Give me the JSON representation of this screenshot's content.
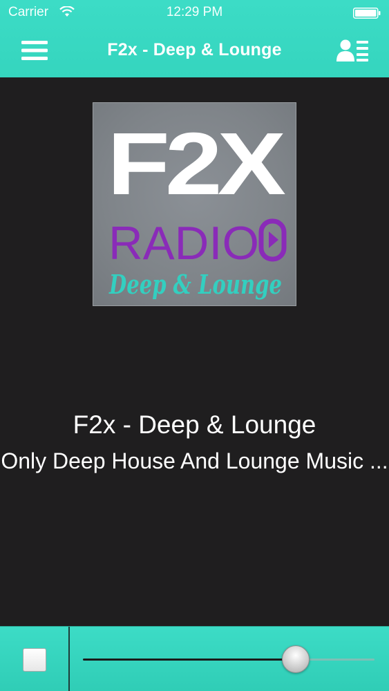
{
  "status_bar": {
    "carrier": "Carrier",
    "time": "12:29 PM",
    "wifi_icon": "wifi-icon",
    "battery_icon": "battery-icon"
  },
  "nav": {
    "title": "F2x - Deep & Lounge",
    "left_icon": "menu-icon",
    "right_icon": "profile-list-icon"
  },
  "artwork": {
    "logo_top": "F2X",
    "logo_middle": "RADIO",
    "logo_bottom": "Deep & Lounge",
    "colors": {
      "logo_white": "#ffffff",
      "radio_purple": "#8a2bb8",
      "script_teal": "#33cfc0"
    }
  },
  "station": {
    "name": "F2x - Deep & Lounge",
    "description": "Only Deep House And Lounge Music ..."
  },
  "player": {
    "stop_icon": "stop-icon",
    "volume_fraction": 0.73
  },
  "colors": {
    "accent": "#3cdcc6",
    "background": "#1f1e1f",
    "text": "#ffffff"
  }
}
